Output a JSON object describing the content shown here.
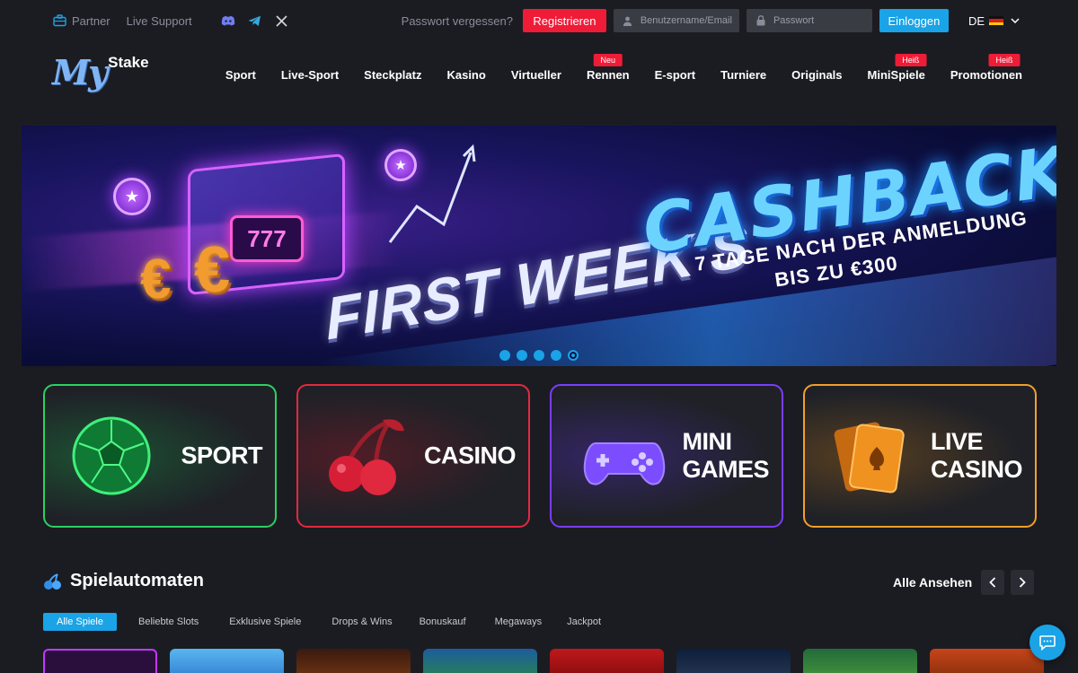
{
  "topbar": {
    "partner_label": "Partner",
    "support_label": "Live Support",
    "social_icons": [
      "discord-icon",
      "telegram-icon",
      "x-icon"
    ],
    "forgot_password": "Passwort vergessen?",
    "register_label": "Registrieren",
    "username_placeholder": "Benutzername/Email",
    "password_placeholder": "Passwort",
    "login_label": "Einloggen",
    "language": "DE"
  },
  "logo": {
    "my": "My",
    "stake": "Stake"
  },
  "nav": {
    "items": [
      {
        "label": "Sport"
      },
      {
        "label": "Live-Sport"
      },
      {
        "label": "Steckplatz"
      },
      {
        "label": "Kasino"
      },
      {
        "label": "Virtueller"
      },
      {
        "label": "Rennen",
        "badge": "Neu"
      },
      {
        "label": "E-sport"
      },
      {
        "label": "Turniere"
      },
      {
        "label": "Originals"
      },
      {
        "label": "MiniSpiele",
        "badge": "Heiß"
      },
      {
        "label": "Promotionen",
        "badge": "Heiß"
      }
    ]
  },
  "banner": {
    "headline": "CASHBACK",
    "subline1": "7 TAGE NACH DER ANMELDUNG",
    "subline2": "BIS ZU €300",
    "left_title": "FIRST WEEK'S",
    "slot_text": "777",
    "slide_count": 5,
    "active_slide": 5
  },
  "categories": [
    {
      "line1": "SPORT",
      "line2": ""
    },
    {
      "line1": "CASINO",
      "line2": ""
    },
    {
      "line1": "MINI",
      "line2": "GAMES"
    },
    {
      "line1": "LIVE",
      "line2": "CASINO"
    }
  ],
  "section": {
    "title": "Spielautomaten",
    "see_all": "Alle Ansehen",
    "filters": [
      "Alle Spiele",
      "Beliebte Slots",
      "Exklusive Spiele",
      "Drops & Wins",
      "Bonuskauf",
      "Megaways",
      "Jackpot"
    ]
  },
  "colors": {
    "accent": "#1aa3e6",
    "register": "#ef1c37",
    "sport_border": "#2bd162",
    "casino_border": "#e4283e",
    "mini_border": "#7a3cff",
    "live_border": "#f0a02a"
  }
}
